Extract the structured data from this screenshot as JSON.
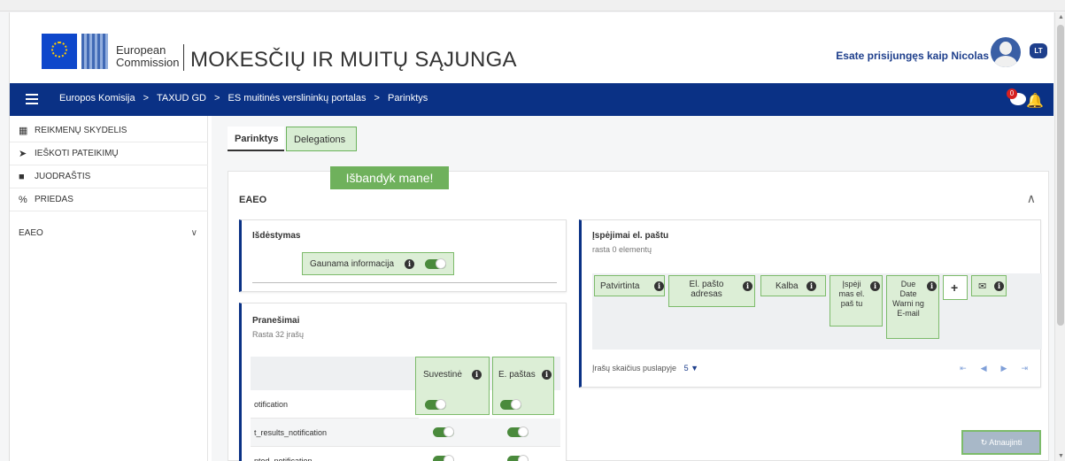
{
  "header": {
    "ec_line1": "European",
    "ec_line2": "Commission",
    "site_title": "MOKESČIŲ IR MUITŲ SĄJUNGA",
    "login_text": "Esate prisijungęs kaip Nicolas",
    "lang": "LT"
  },
  "nav": {
    "breadcrumbs": [
      "Europos Komisija",
      "TAXUD GD",
      "ES muitinės verslininkų portalas",
      "Parinktys"
    ],
    "separator": ">",
    "chat_badge": "0"
  },
  "sidebar": {
    "items": [
      {
        "label": "REIKMENŲ SKYDELIS",
        "icon": "dashboard-icon"
      },
      {
        "label": "IEŠKOTI PATEIKIMŲ",
        "icon": "send-icon"
      },
      {
        "label": "JUODRAŠTIS",
        "icon": "file-icon"
      },
      {
        "label": "PRIEDAS",
        "icon": "paperclip-icon"
      },
      {
        "label": "EAEO",
        "icon": ""
      }
    ]
  },
  "tabs": [
    "Parinktys",
    "Delegations"
  ],
  "tooltip": "Išbandyk mane!",
  "panel_title": "EAEO",
  "layout_card": {
    "title": "Išdėstymas",
    "toggle_label": "Gaunama informacija"
  },
  "notifications_card": {
    "title": "Pranešimai",
    "subtitle": "Rasta 32 įrašų",
    "col_summary": "Suvestinė",
    "col_email": "E. paštas",
    "rows": [
      "otification",
      "t_results_notification",
      "pted_notification"
    ]
  },
  "email_card": {
    "title": "Įspėjimai el. paštu",
    "subtitle": "rasta 0 elementų",
    "columns": [
      "Patvirtinta",
      "El. pašto adresas",
      "Kalba",
      "Įspėji mas el. paš tu",
      "Due Date Warni ng E-mail"
    ],
    "pager_label": "Įrašų skaičius puslapyje",
    "pager_value": "5"
  },
  "refresh_label": "Atnaujinti"
}
